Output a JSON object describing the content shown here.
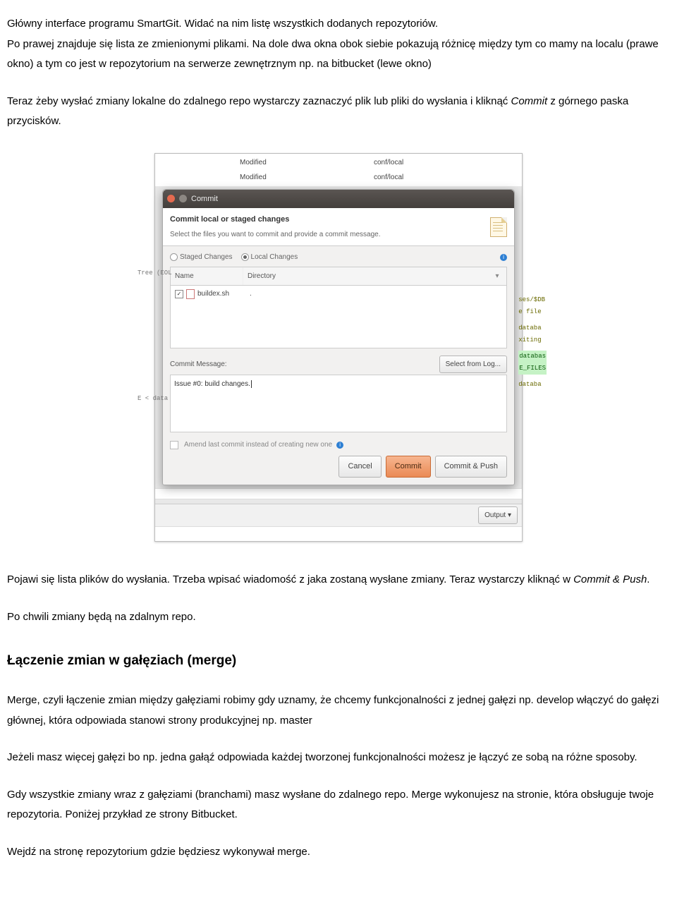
{
  "para1_a": "Główny interface programu SmartGit. Widać na nim listę wszystkich dodanych repozytoriów.",
  "para1_b": "Po prawej znajduje się lista ze zmienionymi plikami. Na dole dwa okna obok siebie pokazują różnicę między tym co mamy na localu (prawe okno) a tym co jest w repozytorium na serwerze zewnętrznym np. na bitbucket (lewe okno)",
  "para2_a": "Teraz żeby wysłać zmiany lokalne do zdalnego repo wystarczy zaznaczyć plik lub pliki do wysłania i kliknąć ",
  "para2_b": "Commit",
  "para2_c": " z górnego paska przycisków.",
  "para3_a": "Pojawi się lista plików do wysłania. Trzeba wpisać wiadomość z jaka zostaną wysłane zmiany. Teraz wystarczy kliknąć w ",
  "para3_b": "Commit & Push",
  "para3_c": ".",
  "para4": "Po chwili zmiany będą na zdalnym repo.",
  "h2": "Łączenie zmian w gałęziach (merge)",
  "para5": "Merge, czyli łączenie zmian między gałęziami robimy gdy uznamy, że chcemy funkcjonalności z jednej gałęzi np. develop włączyć do gałęzi głównej, która odpowiada stanowi strony produkcyjnej np. master",
  "para6": "Jeżeli masz więcej gałęzi bo np. jedna gałąź odpowiada każdej tworzonej funkcjonalności możesz je łączyć ze sobą na różne sposoby.",
  "para7": "Gdy wszystkie zmiany wraz z gałęziami (branchami) masz wysłane do zdalnego repo. Merge wykonujesz na stronie, która obsługuje twoje repozytoria. Poniżej przykład ze strony Bitbucket.",
  "para8": "Wejdź na stronę repozytorium gdzie będziesz wykonywał merge.",
  "shot": {
    "bgRows": [
      {
        "c1": "",
        "c2": "Modified",
        "c3": "conf/local"
      },
      {
        "c1": "",
        "c2": "Modified",
        "c3": "conf/local"
      }
    ],
    "title": "Commit",
    "headTitle": "Commit local or staged changes",
    "headSub": "Select the files you want to commit and provide a commit message.",
    "radioStaged": "Staged Changes",
    "radioLocal": "Local Changes",
    "colName": "Name",
    "colDir": "Directory",
    "fileName": "buildex.sh",
    "fileDir": ".",
    "msgLabel": "Commit Message:",
    "selectFromLog": "Select from Log...",
    "commitMsg": "Issue #0: build changes.",
    "amend": "Amend last commit instead of creating new one",
    "btnCancel": "Cancel",
    "btnCommit": "Commit",
    "btnCommitPush": "Commit & Push",
    "output": "Output",
    "leftEdgeTop": "Tree (EOL",
    "leftEdgeBot": "E < data",
    "rightSnippets": [
      "ses/$DB",
      "e file",
      "databa",
      "xiting",
      "databas",
      "E_FILES",
      "databa"
    ]
  }
}
